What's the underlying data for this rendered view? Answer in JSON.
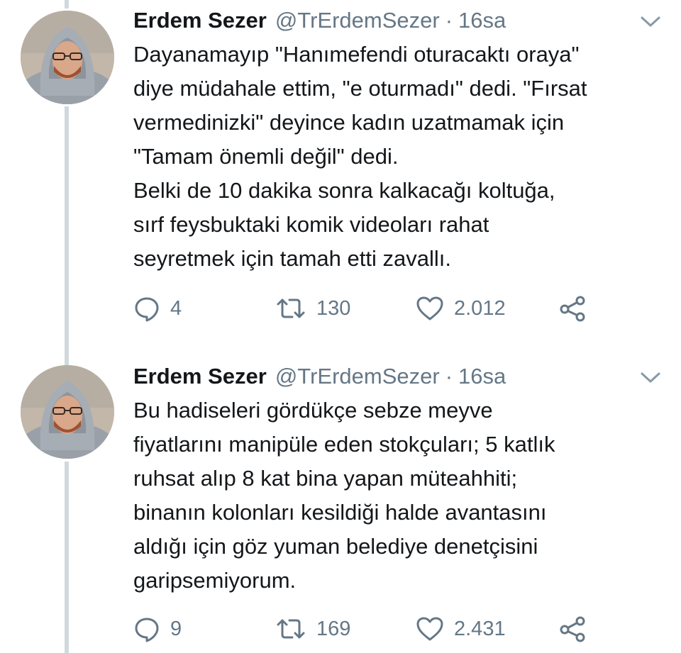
{
  "tweets": [
    {
      "author": {
        "name": "Erdem Sezer",
        "handle": "@TrErdemSezer"
      },
      "separator": "·",
      "time": "16sa",
      "text": "Dayanamayıp \"Hanımefendi oturacaktı oraya\"\ndiye müdahale ettim, \"e oturmadı\" dedi. \"Fırsat\nvermedinizki\" deyince kadın uzatmamak için\n\"Tamam önemli değil\" dedi.\nBelki de 10 dakika sonra kalkacağı koltuğa,\nsırf feysbuktaki komik videoları rahat\nseyretmek için tamah etti zavallı.",
      "replies": "4",
      "retweets": "130",
      "likes": "2.012"
    },
    {
      "author": {
        "name": "Erdem Sezer",
        "handle": "@TrErdemSezer"
      },
      "separator": "·",
      "time": "16sa",
      "text": "Bu hadiseleri gördükçe sebze meyve\nfiyatlarını manipüle eden stokçuları; 5 katlık\nruhsat alıp 8 kat bina yapan müteahhiti;\nbinanın kolonları kesildiği halde avantasını\naldığı için göz yuman belediye denetçisini\ngaripsemiyorum.",
      "replies": "9",
      "retweets": "169",
      "likes": "2.431"
    }
  ],
  "icons": {
    "reply": "reply-icon",
    "retweet": "retweet-icon",
    "like": "heart-icon",
    "share": "share-icon",
    "caret": "chevron-down-icon"
  },
  "colors": {
    "text": "#14171a",
    "secondary": "#657786",
    "thread_line": "#cfd9de",
    "background": "#ffffff"
  }
}
